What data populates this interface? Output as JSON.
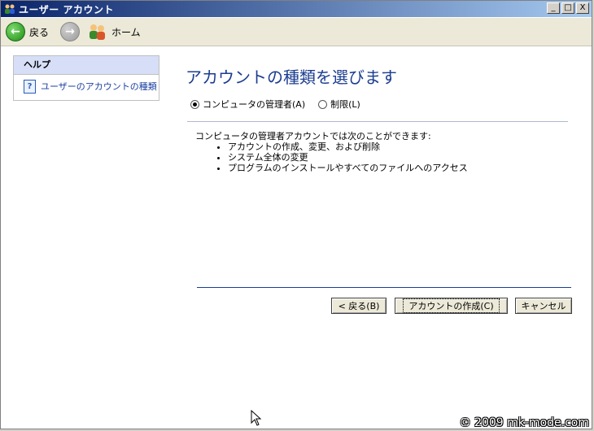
{
  "window": {
    "title": "ユーザー アカウント",
    "minimize": "_",
    "maximize": "□",
    "close": "X"
  },
  "toolbar": {
    "back_label": "戻る",
    "home_label": "ホーム"
  },
  "sidebar": {
    "header": "ヘルプ",
    "items": [
      {
        "label": "ユーザーのアカウントの種類",
        "icon": "help-icon"
      }
    ]
  },
  "main": {
    "heading": "アカウントの種類を選びます",
    "radios": [
      {
        "label": "コンピュータの管理者(A)",
        "checked": true
      },
      {
        "label": "制限(L)",
        "checked": false
      }
    ],
    "description_intro": "コンピュータの管理者アカウントでは次のことができます:",
    "bullets": [
      "アカウントの作成、変更、および削除",
      "システム全体の変更",
      "プログラムのインストールやすべてのファイルへのアクセス"
    ],
    "buttons": {
      "back": "< 戻る(B)",
      "create": "アカウントの作成(C)",
      "cancel": "キャンセル"
    }
  },
  "watermark": "© 2009 mk-mode.com"
}
